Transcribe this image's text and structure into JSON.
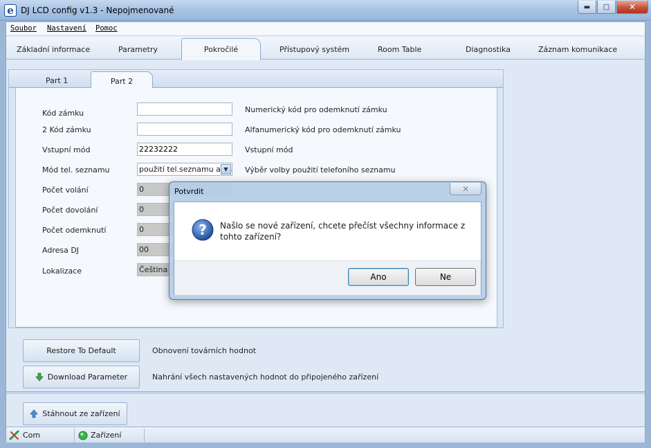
{
  "window": {
    "title": "DJ LCD config v1.3 - Nepojmenované",
    "icon_letter": "e",
    "minimize_glyph": "▬",
    "maximize_glyph": "□",
    "close_glyph": "✕"
  },
  "menu": {
    "items": [
      {
        "label": "Soubor"
      },
      {
        "label": "Nastavení"
      },
      {
        "label": "Pomoc"
      }
    ]
  },
  "tabs": [
    {
      "label": "Základní informace"
    },
    {
      "label": "Parametry"
    },
    {
      "label": "Pokročilé",
      "active": true
    },
    {
      "label": "Přístupový systém"
    },
    {
      "label": "Room Table"
    },
    {
      "label": "Diagnostika"
    },
    {
      "label": "Záznam komunikace"
    }
  ],
  "subtabs": [
    {
      "label": "Part 1"
    },
    {
      "label": "Part 2",
      "active": true
    }
  ],
  "form": {
    "rows": [
      {
        "label": "Kód zámku",
        "value": "",
        "description": "Numerický kód pro odemknutí zámku"
      },
      {
        "label": "2 Kód zámku",
        "value": "",
        "description": "Alfanumerický kód pro odemknutí zámku"
      },
      {
        "label": "Vstupní mód",
        "value": "22232222",
        "description": "Vstupní mód"
      },
      {
        "label": "Mód tel. seznamu",
        "value": "použití tel.seznamu a pravidel",
        "description": "Výběr volby použití telefoního seznamu"
      },
      {
        "label": "Počet volání",
        "value": "0"
      },
      {
        "label": "Počet dovolání",
        "value": "0"
      },
      {
        "label": "Počet odemknutí",
        "value": "0"
      },
      {
        "label": "Adresa DJ",
        "value": "00"
      },
      {
        "label": "Lokalizace",
        "value": "Čeština"
      }
    ],
    "select_arrow": "▼"
  },
  "actions": {
    "restore_label": "Restore To Default",
    "restore_desc": "Obnovení továrních hodnot",
    "download_label": "Download Parameter",
    "download_desc": "Nahrání všech nastavených hodnot do připojeného zařízení",
    "fetch_label": "Stáhnout ze zařízení"
  },
  "status": {
    "com_label": "Com",
    "device_label": "Zařízení"
  },
  "dialog": {
    "title": "Potvrdit",
    "close_glyph": "✕",
    "message": "Našlo se nové zařízení, chcete přečíst všechny informace z tohto zařízení?",
    "yes_label": "Ano",
    "no_label": "Ne",
    "icon_glyph": "?"
  },
  "colors": {
    "accent": "#3c7fb1",
    "status_com": "#2e9e3a",
    "status_device": "#3bb54a",
    "question_blue": "#2a5aa8"
  }
}
